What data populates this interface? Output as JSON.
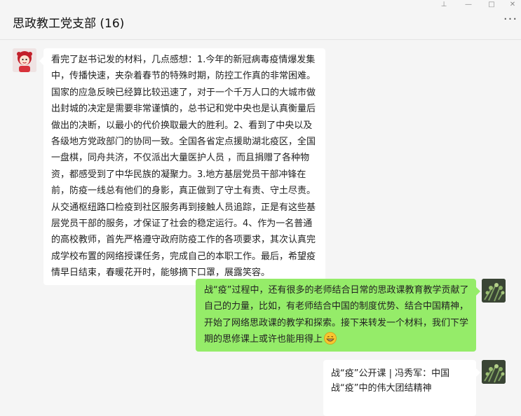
{
  "window": {
    "title": "思政教工党支部 (16)",
    "pin_glyph": "⊥",
    "minimize_glyph": "—",
    "maximize_glyph": "□",
    "close_glyph": "✕",
    "more_glyph": "···"
  },
  "messages": [
    {
      "side": "left",
      "sender_avatar": "avatar-cartoon-girl",
      "text": "看完了赵书记发的材料，几点感想：1.今年的新冠病毒疫情爆发集中，传播快速，夹杂着春节的特殊时期，防控工作真的非常困难。国家的应急反映已经算比较迅速了，对于一个千万人口的大城市做出封城的决定是需要非常谨慎的，总书记和党中央也是认真衡量后做出的决断，以最小的代价换取最大的胜利。2、看到了中央以及各级地方党政部门的协同一致。全国各省定点援助湖北疫区，全国一盘棋，同舟共济，不仅派出大量医护人员 ，而且捐赠了各种物资，都感受到了中华民族的凝聚力。3.地方基层党员干部冲锋在前，防疫一线总有他们的身影，真正做到了守土有责、守土尽责。从交通枢纽路口检疫到社区服务再到接触人员追踪，正是有这些基层党员干部的服务，才保证了社会的稳定运行。4、作为一名普通的高校教师，首先严格遵守政府防疫工作的各项要求，其次认真完成学校布置的网络授课任务，完成自己的本职工作。最后，希望疫情早日结束，春暖花开时，能够摘下口罩，展露笑容。"
    },
    {
      "side": "right",
      "sender_avatar": "avatar-plant-photo",
      "text": "战“疫”过程中，还有很多的老师结合日常的思政课教育教学贡献了自己的力量，比如，有老师结合中国的制度优势、结合中国精神，开始了网络思政课的教学和探索。接下来转发一个材料，我们下学期的思修课上或许也能用得上",
      "emoji": "grin-emoji"
    },
    {
      "side": "right",
      "sender_avatar": "avatar-plant-photo",
      "card_title": "战“疫”公开课 | 冯秀军：中国战“疫”中的伟大团结精神"
    }
  ],
  "colors": {
    "background": "#f5f5f5",
    "bubble_self": "#95ec69",
    "bubble_other": "#ffffff"
  }
}
